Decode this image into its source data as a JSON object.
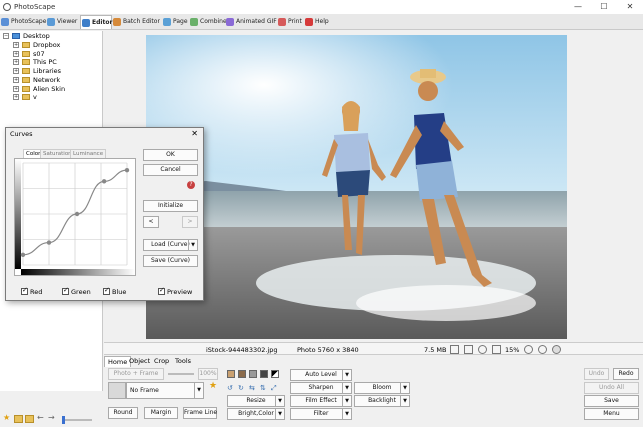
{
  "window": {
    "title": "PhotoScape",
    "minimize": "—",
    "maximize": "☐",
    "close": "✕"
  },
  "tabs": [
    {
      "label": "PhotoScape",
      "color": "#5a8fd6"
    },
    {
      "label": "Viewer",
      "color": "#5a9ad6"
    },
    {
      "label": "Editor",
      "color": "#3f7fc9"
    },
    {
      "label": "Batch Editor",
      "color": "#d68a3a"
    },
    {
      "label": "Page",
      "color": "#5aa0d6"
    },
    {
      "label": "Combine",
      "color": "#6ab06a"
    },
    {
      "label": "Animated GIF",
      "color": "#8a6ad6"
    },
    {
      "label": "Print",
      "color": "#d65a5a"
    },
    {
      "label": "Help",
      "color": "#d63a3a"
    }
  ],
  "tree": {
    "root": "Desktop",
    "items": [
      "Dropbox",
      "s07",
      "This PC",
      "Libraries",
      "Network",
      "Alien Skin",
      "v"
    ]
  },
  "status": {
    "filename": "iStock-944483302.jpg",
    "dimensions": "Photo 5760 x 3840",
    "filesize": "7.5 MB",
    "zoom": "15%"
  },
  "editor_tabs": [
    "Home",
    "Object",
    "Crop",
    "Tools"
  ],
  "home": {
    "photo_frame": "Photo + Frame",
    "frame_percent": "100%",
    "frame_select": "No Frame",
    "round": "Round",
    "margin": "Margin",
    "frame_line": "Frame Line",
    "auto_level": "Auto Level",
    "sharpen": "Sharpen",
    "film_effect": "Film Effect",
    "filter": "Filter",
    "resize": "Resize",
    "bright_color": "Bright,Color",
    "bloom": "Bloom",
    "backlight": "Backlight"
  },
  "right_buttons": {
    "undo": "Undo",
    "redo": "Redo",
    "undo_all": "Undo All",
    "save": "Save",
    "menu": "Menu"
  },
  "curves": {
    "title": "Curves",
    "tabs": [
      "Color",
      "Saturation",
      "Luminance"
    ],
    "ok": "OK",
    "cancel": "Cancel",
    "help": "?",
    "initialize": "Initialize",
    "prev": "<",
    "next": ">",
    "load_curve": "Load (Curve)",
    "save_curve": "Save (Curve)",
    "channels": [
      {
        "label": "Red",
        "checked": true
      },
      {
        "label": "Green",
        "checked": true
      },
      {
        "label": "Blue",
        "checked": true
      }
    ],
    "preview": {
      "label": "Preview",
      "checked": true
    },
    "points": [
      [
        0,
        0.1
      ],
      [
        0.25,
        0.22
      ],
      [
        0.52,
        0.5
      ],
      [
        0.78,
        0.82
      ],
      [
        1,
        0.93
      ]
    ]
  }
}
